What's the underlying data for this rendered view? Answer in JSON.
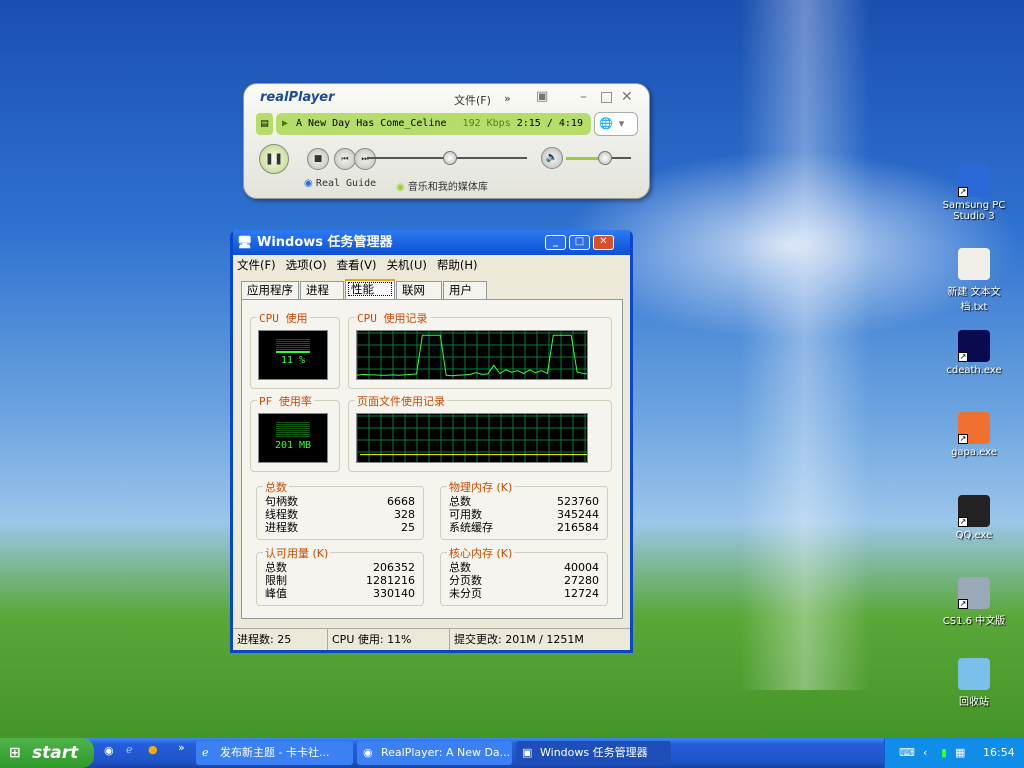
{
  "desktop": {
    "icons": [
      {
        "label": "Samsung PC Studio 3",
        "icon": "samsung-pc-studio-icon",
        "color": "#2a6ad8"
      },
      {
        "label": "新建 文本文档.txt",
        "icon": "text-file-icon",
        "color": "#f0f0e8"
      },
      {
        "label": "cdeath.exe",
        "icon": "cdeath-icon",
        "color": "#0a0a50"
      },
      {
        "label": "gapa.exe",
        "icon": "gapa-icon",
        "color": "#f07030"
      },
      {
        "label": "QQ.exe",
        "icon": "qq-penguin-icon",
        "color": "#222222"
      },
      {
        "label": "CS1.6 中文版",
        "icon": "counter-strike-icon",
        "color": "#9aa8b8"
      },
      {
        "label": "回收站",
        "icon": "recycle-bin-icon",
        "color": "#7ac0e8"
      }
    ]
  },
  "realplayer": {
    "logo": "realPlayer",
    "menu_file": "文件(F)",
    "more": "»",
    "track": "A New Day Has Come_Celine",
    "bitrate": "192 Kbps",
    "time": "2:15 / 4:19",
    "position_fraction": 0.52,
    "volume_fraction": 0.6,
    "real_guide": "Real Guide",
    "library": "音乐和我的媒体库"
  },
  "taskmgr": {
    "title": "Windows 任务管理器",
    "menu": [
      "文件(F)",
      "选项(O)",
      "查看(V)",
      "关机(U)",
      "帮助(H)"
    ],
    "tabs": [
      "应用程序",
      "进程",
      "性能",
      "联网",
      "用户"
    ],
    "active_tab": 2,
    "cpu_label": "CPU 使用",
    "cpu_value": "11 %",
    "cpu_history_label": "CPU 使用记录",
    "pf_label": "PF 使用率",
    "pf_value": "201 MB",
    "pf_history_label": "页面文件使用记录",
    "cpu_history": [
      8,
      10,
      9,
      9,
      8,
      8,
      9,
      8,
      9,
      10,
      11,
      95,
      95,
      95,
      95,
      8,
      7,
      8,
      9,
      10,
      14,
      10,
      11,
      30,
      12,
      20,
      15,
      18,
      12,
      20,
      14,
      18,
      12,
      95,
      95,
      95,
      95,
      15,
      12,
      11
    ],
    "pf_history_fraction": 0.16,
    "totals": {
      "title": "总数",
      "rows": [
        [
          "句柄数",
          "6668"
        ],
        [
          "线程数",
          "328"
        ],
        [
          "进程数",
          "25"
        ]
      ]
    },
    "physical": {
      "title": "物理内存 (K)",
      "rows": [
        [
          "总数",
          "523760"
        ],
        [
          "可用数",
          "345244"
        ],
        [
          "系统缓存",
          "216584"
        ]
      ]
    },
    "commit": {
      "title": "认可用量 (K)",
      "rows": [
        [
          "总数",
          "206352"
        ],
        [
          "限制",
          "1281216"
        ],
        [
          "峰值",
          "330140"
        ]
      ]
    },
    "kernel": {
      "title": "核心内存 (K)",
      "rows": [
        [
          "总数",
          "40004"
        ],
        [
          "分页数",
          "27280"
        ],
        [
          "未分页",
          "12724"
        ]
      ]
    },
    "status": [
      "进程数: 25",
      "CPU 使用: 11%",
      "提交更改: 201M / 1251M"
    ]
  },
  "taskbar": {
    "start": "start",
    "more": "»",
    "tasks": [
      "发布新主题 - 卡卡社...",
      "RealPlayer: A New Da...",
      "Windows 任务管理器"
    ],
    "clock": "16:54"
  }
}
